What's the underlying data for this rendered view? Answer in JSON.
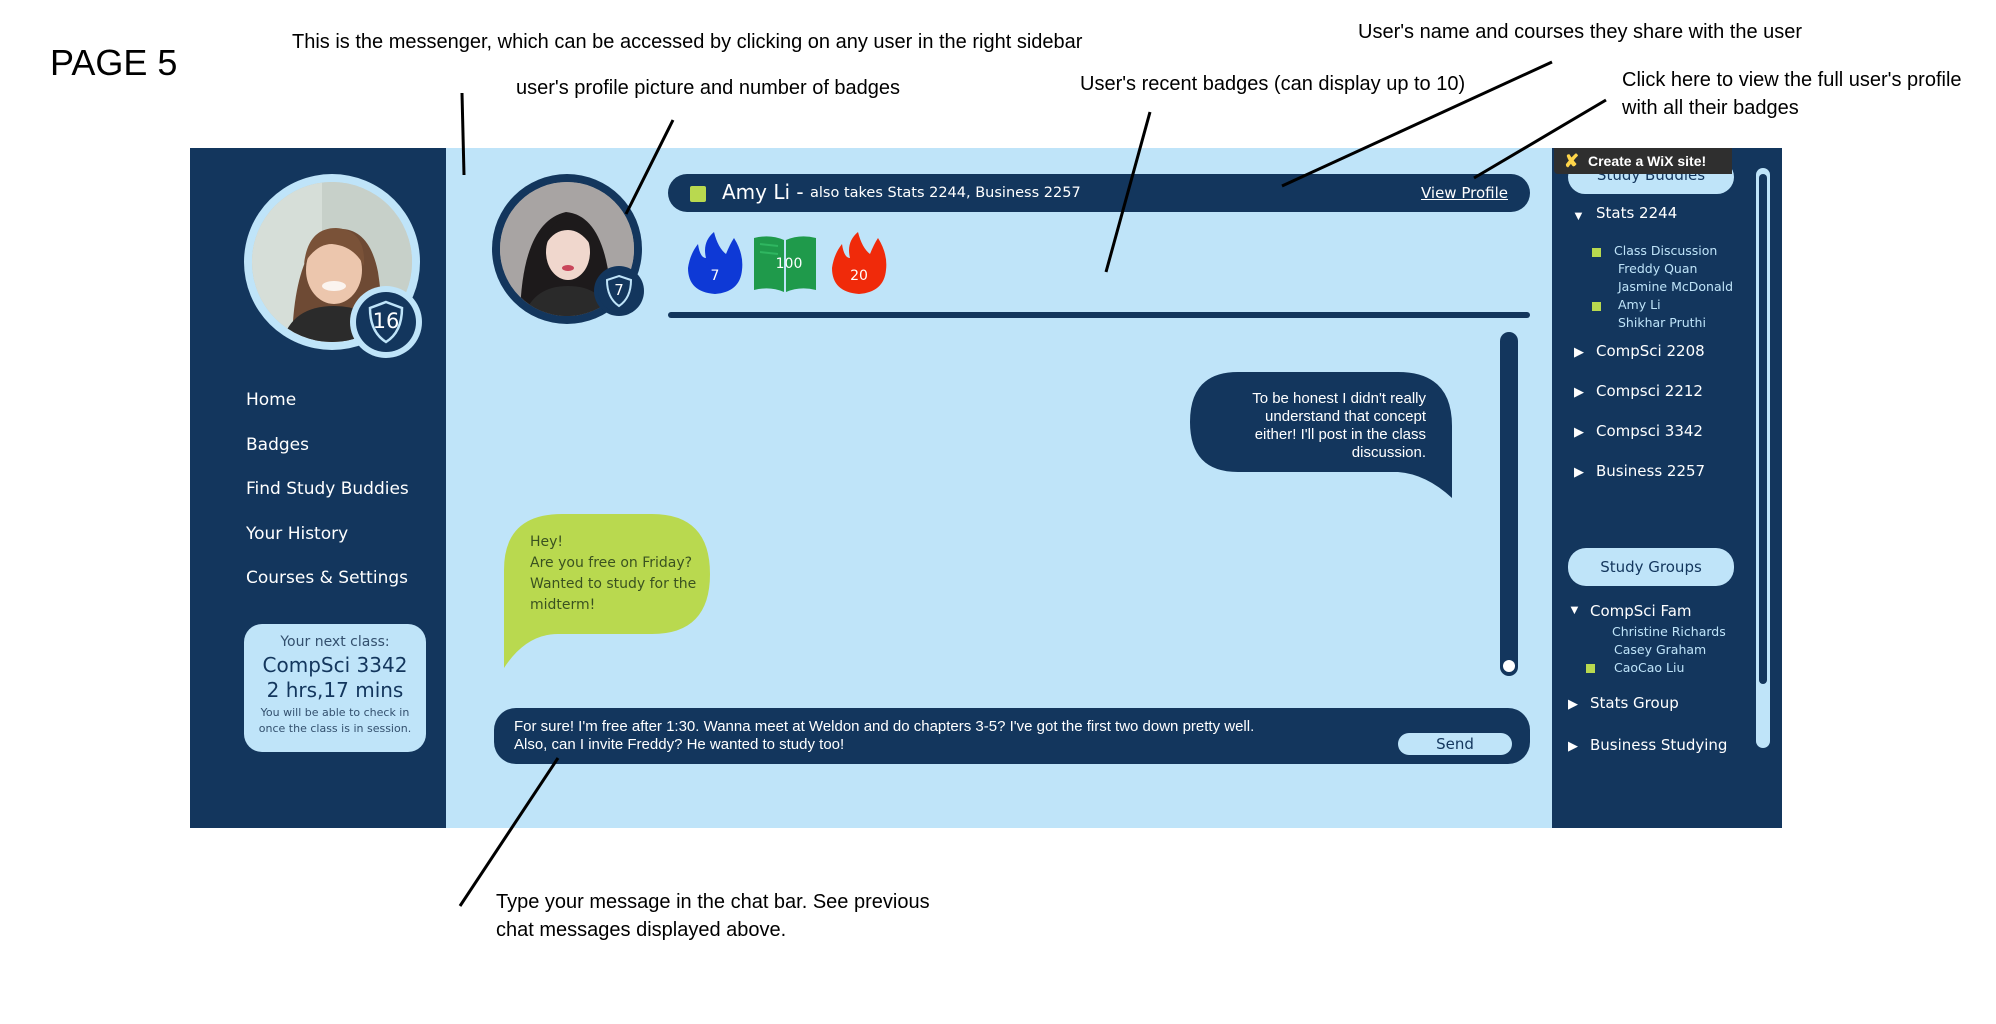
{
  "page_label": "PAGE 5",
  "annotations": {
    "messenger": "This is the messenger, which can be accessed by clicking on any user in the right sidebar",
    "profile_picture": "user's profile picture and number of badges",
    "recent_badges": "User's recent badges (can display up to 10)",
    "name_courses": "User's name and courses they share with the user",
    "view_profile_line1": "Click here to view the full user's profile",
    "view_profile_line2": "with all their badges",
    "chat_bar_line1": "Type your message in the chat bar. See previous",
    "chat_bar_line2": "chat messages displayed above."
  },
  "left_sidebar": {
    "badge_count": "16",
    "nav": [
      "Home",
      "Badges",
      "Find Study Buddies",
      "Your History",
      "Courses & Settings"
    ],
    "next_class": {
      "label": "Your next class:",
      "course": "CompSci 3342",
      "time": "2 hrs,17 mins",
      "note_line1": "You will be able to check in",
      "note_line2": "once the class is in session."
    }
  },
  "chat_user": {
    "badge_count": "7",
    "name": "Amy Li -",
    "courses": "also takes Stats 2244, Business 2257",
    "view_profile": "View Profile",
    "badges": [
      {
        "value": "7",
        "color": "#0e39d6",
        "icon": "flame-icon"
      },
      {
        "value": "100",
        "color": "#1f9a4b",
        "icon": "book-icon"
      },
      {
        "value": "20",
        "color": "#f02a0a",
        "icon": "flame-icon"
      }
    ]
  },
  "messages": {
    "outgoing": [
      "To be honest I didn't really",
      "understand that concept",
      "either! I'll post in the class",
      "discussion."
    ],
    "incoming": [
      "Hey!",
      "Are you free on Friday?",
      "Wanted to study for the",
      "midterm!"
    ]
  },
  "chat_input": {
    "line1": "For sure! I'm free after 1:30. Wanna meet at Weldon and do chapters 3-5? I've got the first two down pretty well.",
    "line2": "Also, can I invite Freddy? He wanted to study too!",
    "send_label": "Send"
  },
  "right_sidebar": {
    "wix_banner": "Create a WiX site!",
    "study_buddies_label": "Study Buddies",
    "buddy_groups": [
      {
        "name": "Stats 2244",
        "expanded": true,
        "members": [
          {
            "name": "Class Discussion",
            "online": true
          },
          {
            "name": "Freddy Quan",
            "online": false
          },
          {
            "name": "Jasmine McDonald",
            "online": false
          },
          {
            "name": "Amy Li",
            "online": true
          },
          {
            "name": "Shikhar Pruthi",
            "online": false
          }
        ]
      },
      {
        "name": "CompSci 2208",
        "expanded": false
      },
      {
        "name": "Compsci 2212",
        "expanded": false
      },
      {
        "name": "Compsci 3342",
        "expanded": false
      },
      {
        "name": "Business 2257",
        "expanded": false
      }
    ],
    "study_groups_label": "Study Groups",
    "groups": [
      {
        "name": "CompSci Fam",
        "expanded": true,
        "members": [
          {
            "name": "Christine Richards",
            "online": false
          },
          {
            "name": "Casey Graham",
            "online": false
          },
          {
            "name": "CaoCao Liu",
            "online": true
          }
        ]
      },
      {
        "name": "Stats Group",
        "expanded": false
      },
      {
        "name": "Business Studying",
        "expanded": false
      }
    ]
  },
  "colors": {
    "navy": "#13365d",
    "light_blue": "#bfe4f9",
    "lime": "#b9d94f"
  }
}
